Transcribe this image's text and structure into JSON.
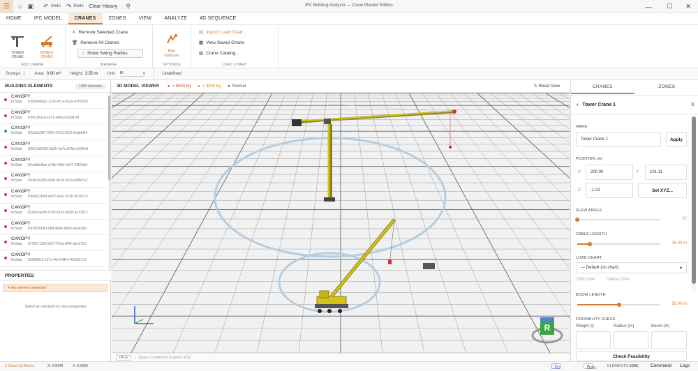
{
  "titlebar": {
    "undo": "Undo",
    "redo": "Redo",
    "clear_history": "Clear History",
    "title": "IFC Building Analyzer — Crane Planner Edition"
  },
  "menu": {
    "home": "HOME",
    "ifc_model": "IFC MODEL",
    "cranes": "CRANES",
    "zones": "ZONES",
    "view": "VIEW",
    "analyze": "ANALYZE",
    "seq": "4D SEQUENCE"
  },
  "ribbon": {
    "tower": "TOWER",
    "tower2": "CRANE",
    "mobile": "MOBILE",
    "mobile2": "CRANE",
    "add_group": "ADD CRANE",
    "remove_selected": "Remove Selected Crane",
    "remove_all": "Remove All Cranes",
    "show_swing": "Show Swing Radius",
    "manage_group": "MANAGE",
    "run": "Run",
    "optimizer": "Optimizer",
    "optimize_group": "OPTIMIZE",
    "import_chart": "Import Load Chart...",
    "view_saved": "View Saved Charts",
    "crane_catalog": "Crane Catalog...",
    "load_group": "LOAD CHART"
  },
  "info": {
    "storeys_l": "Storeys:",
    "storeys_v": "1",
    "area_l": "Area:",
    "area_v": "0.00 m²",
    "height_l": "Height:",
    "height_v": "3.50 m",
    "unit_l": "Unit:",
    "unit_v": "m",
    "undefined": "Undefined"
  },
  "left": {
    "title": "BUILDING ELEMENTS",
    "count": "1055 elements",
    "items": [
      {
        "name": "CANOPY",
        "type": "IfcSlab",
        "id": "ID55b68ba1-1c55-47ca-8a3e-4705355",
        "color": "#d23b3b"
      },
      {
        "name": "CANOPY",
        "type": "IfcSlab",
        "id": "IDf4c305c6-e271-948a-d15b8cbf",
        "color": "#d23b3b"
      },
      {
        "name": "CANOPY",
        "type": "IfcSlab",
        "id": "ID0e9a33f7-2354-4121-831f-2edb5fb4",
        "color": "#2ea84a"
      },
      {
        "name": "CANOPY",
        "type": "IfcSlab",
        "id": "IDfb31d5455-9d30-4a7a-878a-c0540df",
        "color": "#d23b3b"
      },
      {
        "name": "CANOPY",
        "type": "IfcSlab",
        "id": "IDea98e8ae-c7db-438e-b427-2f10b5d",
        "color": "#d23b3b"
      },
      {
        "name": "CANOPY",
        "type": "IfcSlab",
        "id": "IDcdc3c258-d0e0-461b-92ca-b98e7e2",
        "color": "#d23b3b"
      },
      {
        "name": "CANOPY",
        "type": "IfcSlab",
        "id": "ID6ab22b94-ec52-4c42-9c2b-3019c19",
        "color": "#d23b3b"
      },
      {
        "name": "CANOPY",
        "type": "IfcSlab",
        "id": "ID3e5cae38-c7b6-41d1-b828-a211912",
        "color": "#d23b3b"
      },
      {
        "name": "CANOPY",
        "type": "IfcSlab",
        "id": "IDb7b25683-0fdf-4b43-89b6-a00e1be",
        "color": "#d23b3b"
      },
      {
        "name": "CANOPY",
        "type": "IfcSlab",
        "id": "ID706712f9-6567-419a-8f44-abc975d",
        "color": "#d23b3b"
      },
      {
        "name": "CANOPY",
        "type": "IfcSlab",
        "id": "ID2f9ff6c5-117c-40c4-8fe4-40d3f17c9",
        "color": "#d23b3b"
      }
    ],
    "props_title": "PROPERTIES",
    "no_sel": "No element selected",
    "hint": "Select an element to view properties"
  },
  "viewer": {
    "title": "3D MODEL VIEWER",
    "leg1": "> 5000 kg",
    "leg2": "> 3000 kg",
    "leg3": "Normal",
    "reset": "Reset View",
    "idle": "IDLE",
    "cmd_placeholder": "Type a command or press ESC",
    "gizmo": "R"
  },
  "right": {
    "tab1": "CRANES",
    "tab2": "ZONES",
    "crane_title": "Tower Crane 1",
    "close": "X",
    "name_l": "NAME",
    "name_v": "Tower Crane 1",
    "apply": "Apply",
    "pos_l": "POSITION (m)",
    "x_l": "X",
    "x_v": "200.00",
    "y_l": "Y",
    "y_v": "101.11",
    "z_l": "Z",
    "z_v": "-1.02",
    "setxyz": "Set XYZ...",
    "slew_l": "SLEW ANGLE",
    "slew_v": "0°",
    "slew_frac": 0.0,
    "cable_l": "CABLE LENGTH",
    "cable_v": "15.00 m",
    "cable_frac": 0.15,
    "load_l": "LOAD CHART",
    "load_v": "— Default (no chart)",
    "edit": "Edit Chart",
    "delete": "Delete Chart",
    "boom_l": "BOOM LENGTH",
    "boom_v": "50.00 m",
    "boom_frac": 0.5,
    "feas_l": "FEASIBILITY CHECK",
    "weight_l": "Weight (t)",
    "radius_l": "Radius (m)",
    "boomm_l": "Boom (m)",
    "check": "Check Feasibility"
  },
  "status": {
    "active": "2 Crane(s) Active",
    "x": "X: 0.00M",
    "y": "Y: 0.00M",
    "hd": "HD",
    "osn": "OSN",
    "elements_l": "ELEMENTS:",
    "elements_v": "1055",
    "command": "Command",
    "logs": "Logs"
  },
  "colors": {
    "accent": "#d97a2b",
    "crane": "#d4c21a",
    "red": "#d23b3b",
    "green": "#2ea84a"
  }
}
